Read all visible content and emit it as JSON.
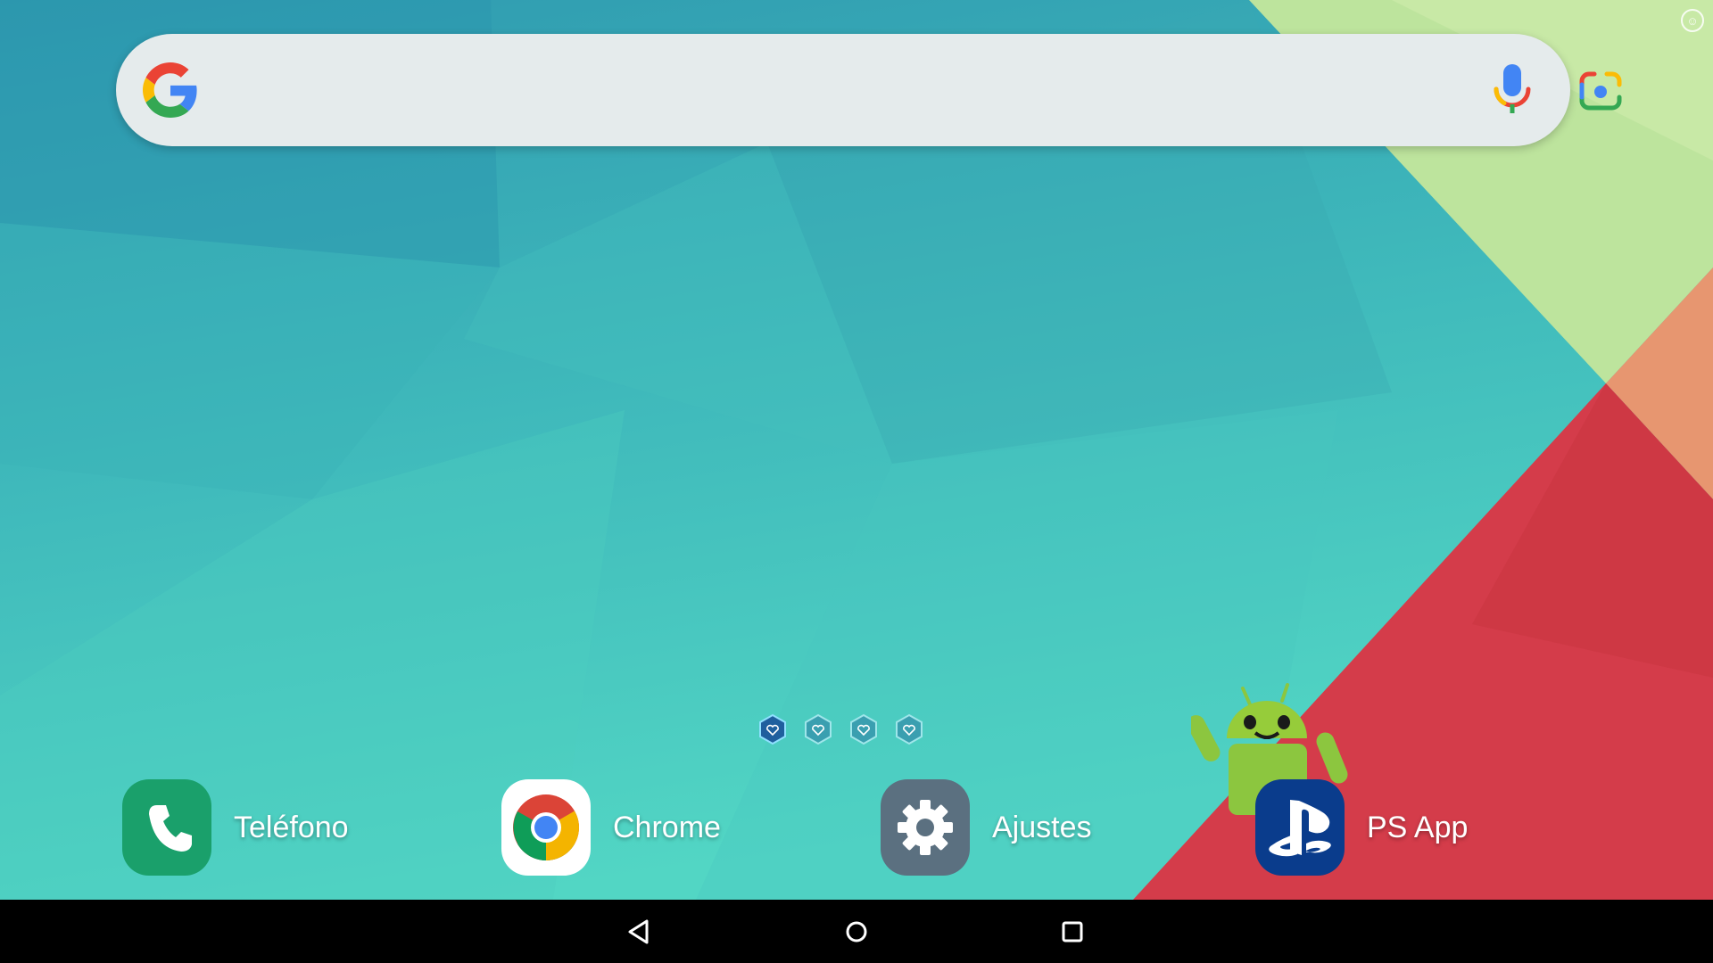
{
  "search_bar": {
    "icons": [
      "google-g-icon",
      "microphone-icon",
      "google-lens-icon"
    ]
  },
  "page_indicator": {
    "count": 4,
    "active_index": 0
  },
  "apps": [
    {
      "label": "Teléfono",
      "icon": "phone-icon",
      "color": "#1aa06b"
    },
    {
      "label": "Chrome",
      "icon": "chrome-icon",
      "color": "#ffffff"
    },
    {
      "label": "Ajustes",
      "icon": "settings-gear-icon",
      "color": "#5b7080"
    },
    {
      "label": "PS App",
      "icon": "playstation-icon",
      "color": "#0a3c8c"
    }
  ],
  "decorations": {
    "mascot": "android-mascot"
  },
  "navigation": {
    "buttons": [
      "back-icon",
      "home-icon",
      "recents-icon"
    ]
  },
  "colors": {
    "wallpaper_teal": "#42bfbb",
    "wallpaper_green": "#bfe39c",
    "wallpaper_red": "#d23e4a",
    "wallpaper_orange": "#e8936c",
    "nav_bar": "#000000"
  }
}
